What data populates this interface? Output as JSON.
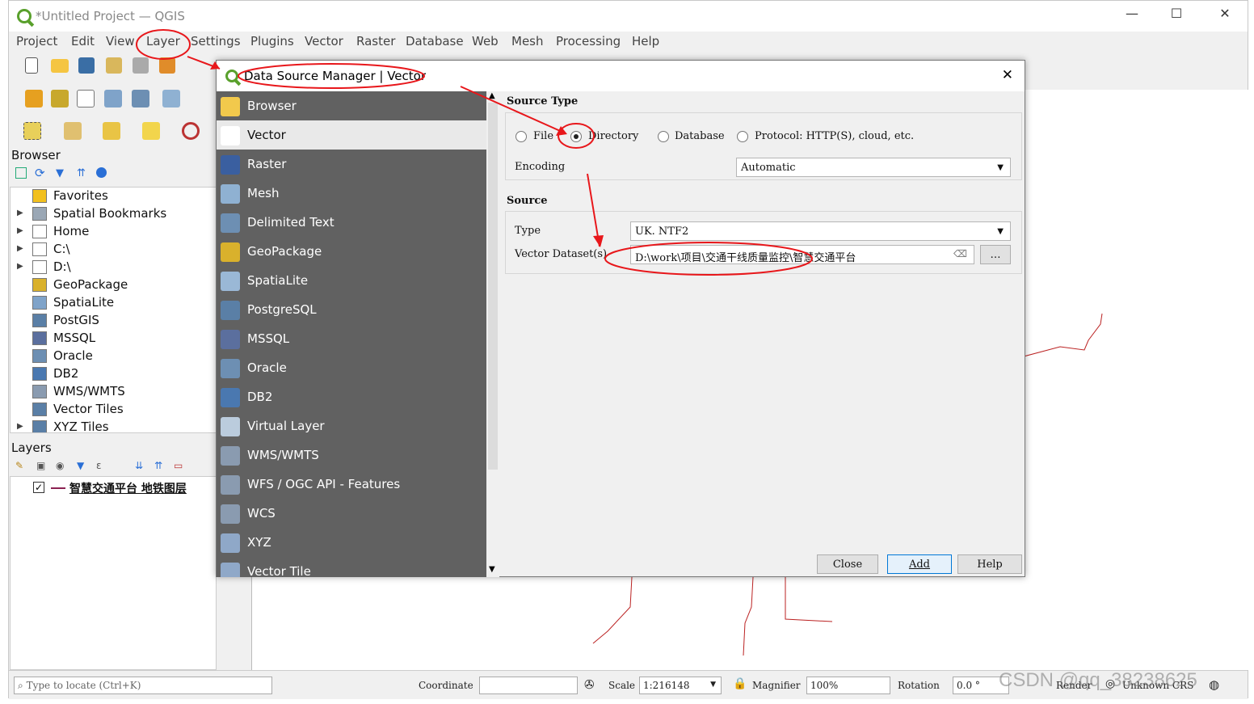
{
  "window": {
    "title": "*Untitled Project — QGIS",
    "minimize": "—",
    "maximize": "☐",
    "close": "✕"
  },
  "menu": [
    "Project",
    "Edit",
    "View",
    "Layer",
    "Settings",
    "Plugins",
    "Vector",
    "Raster",
    "Database",
    "Web",
    "Mesh",
    "Processing",
    "Help"
  ],
  "browser": {
    "title": "Browser",
    "items": [
      {
        "label": "Favorites",
        "icon": "star-icon",
        "expand": false
      },
      {
        "label": "Spatial Bookmarks",
        "icon": "bookmark-icon",
        "expand": true
      },
      {
        "label": "Home",
        "icon": "home-folder-icon",
        "expand": true
      },
      {
        "label": "C:\\",
        "icon": "folder-icon",
        "expand": true
      },
      {
        "label": "D:\\",
        "icon": "folder-icon",
        "expand": true
      },
      {
        "label": "GeoPackage",
        "icon": "geopackage-icon",
        "expand": false
      },
      {
        "label": "SpatiaLite",
        "icon": "spatialite-icon",
        "expand": false
      },
      {
        "label": "PostGIS",
        "icon": "postgis-icon",
        "expand": false
      },
      {
        "label": "MSSQL",
        "icon": "mssql-icon",
        "expand": false
      },
      {
        "label": "Oracle",
        "icon": "oracle-icon",
        "expand": false
      },
      {
        "label": "DB2",
        "icon": "db2-icon",
        "expand": false
      },
      {
        "label": "WMS/WMTS",
        "icon": "globe-icon",
        "expand": false
      },
      {
        "label": "Vector Tiles",
        "icon": "grid-icon",
        "expand": false
      },
      {
        "label": "XYZ Tiles",
        "icon": "grid-icon",
        "expand": true
      }
    ]
  },
  "layers": {
    "title": "Layers",
    "items": [
      {
        "label": "智慧交通平台 地铁图层",
        "checked": true
      }
    ]
  },
  "dialog": {
    "title": "Data Source Manager | Vector",
    "close": "✕",
    "nav": [
      {
        "label": "Browser",
        "icon": "folder-icon"
      },
      {
        "label": "Vector",
        "icon": "vector-icon"
      },
      {
        "label": "Raster",
        "icon": "raster-icon"
      },
      {
        "label": "Mesh",
        "icon": "mesh-icon"
      },
      {
        "label": "Delimited Text",
        "icon": "comma-icon"
      },
      {
        "label": "GeoPackage",
        "icon": "geopackage-icon"
      },
      {
        "label": "SpatiaLite",
        "icon": "spatialite-icon"
      },
      {
        "label": "PostgreSQL",
        "icon": "postgis-icon"
      },
      {
        "label": "MSSQL",
        "icon": "mssql-icon"
      },
      {
        "label": "Oracle",
        "icon": "oracle-icon"
      },
      {
        "label": "DB2",
        "icon": "db2-icon"
      },
      {
        "label": "Virtual Layer",
        "icon": "virtual-layer-icon"
      },
      {
        "label": "WMS/WMTS",
        "icon": "globe-icon"
      },
      {
        "label": "WFS / OGC API - Features",
        "icon": "wfs-icon"
      },
      {
        "label": "WCS",
        "icon": "wcs-icon"
      },
      {
        "label": "XYZ",
        "icon": "grid-icon"
      },
      {
        "label": "Vector Tile",
        "icon": "grid-icon"
      }
    ],
    "selected_nav": "Vector",
    "source_type": {
      "header": "Source Type",
      "options": [
        "File",
        "Directory",
        "Database",
        "Protocol: HTTP(S), cloud, etc."
      ],
      "selected": "Directory",
      "encoding_label": "Encoding",
      "encoding_value": "Automatic"
    },
    "source": {
      "header": "Source",
      "type_label": "Type",
      "type_value": "UK. NTF2",
      "dataset_label": "Vector Dataset(s)",
      "dataset_value": "D:\\work\\项目\\交通干线质量监控\\智慧交通平台",
      "browse": "…"
    },
    "buttons": {
      "close": "Close",
      "add": "Add",
      "help": "Help"
    }
  },
  "statusbar": {
    "locate_placeholder": "Type to locate (Ctrl+K)",
    "coordinate_label": "Coordinate",
    "coordinate_value": "",
    "scale_label": "Scale",
    "scale_value": "1:216148",
    "magnifier_label": "Magnifier",
    "magnifier_value": "100%",
    "rotation_label": "Rotation",
    "rotation_value": "0.0 °",
    "render_label": "Render",
    "crs_label": "Unknown CRS"
  },
  "watermark": "CSDN @qq_38238625",
  "colors": {
    "accent_red": "#e8171b",
    "nav_bg": "#616161",
    "qgis_green": "#59a02c"
  }
}
